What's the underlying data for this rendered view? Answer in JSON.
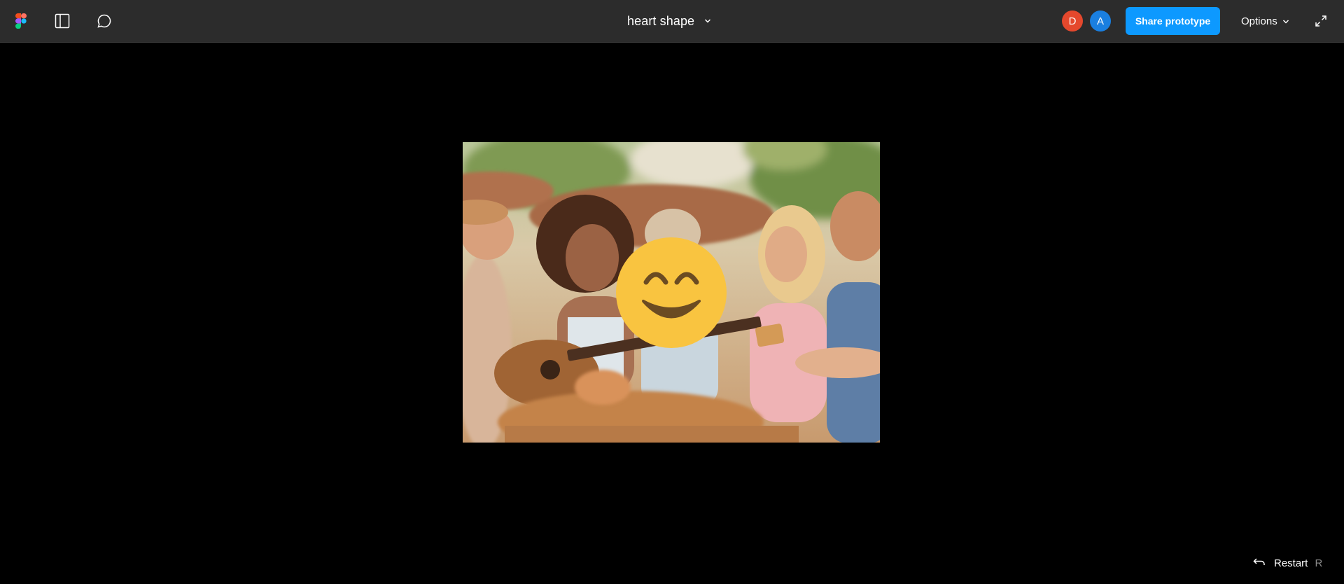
{
  "toolbar": {
    "file_title": "heart shape",
    "share_label": "Share prototype",
    "options_label": "Options",
    "avatars": [
      {
        "initial": "D",
        "color": "#e5482d"
      },
      {
        "initial": "A",
        "color": "#1a7fe0"
      }
    ],
    "icons": {
      "logo": "figma-logo-icon",
      "sidebar": "sidebar-toggle-icon",
      "comment": "comment-icon",
      "title_chevron": "chevron-down-icon",
      "options_chevron": "chevron-down-icon",
      "expand": "expand-icon"
    }
  },
  "canvas": {
    "emoji": "smiling-face-with-smiling-eyes"
  },
  "footer": {
    "restart_label": "Restart",
    "restart_key": "R",
    "restart_icon": "undo-arrow-icon"
  },
  "colors": {
    "accent": "#0d99ff",
    "toolbar_bg": "#2c2c2c",
    "canvas_bg": "#000000",
    "emoji_yellow": "#f9c440"
  }
}
